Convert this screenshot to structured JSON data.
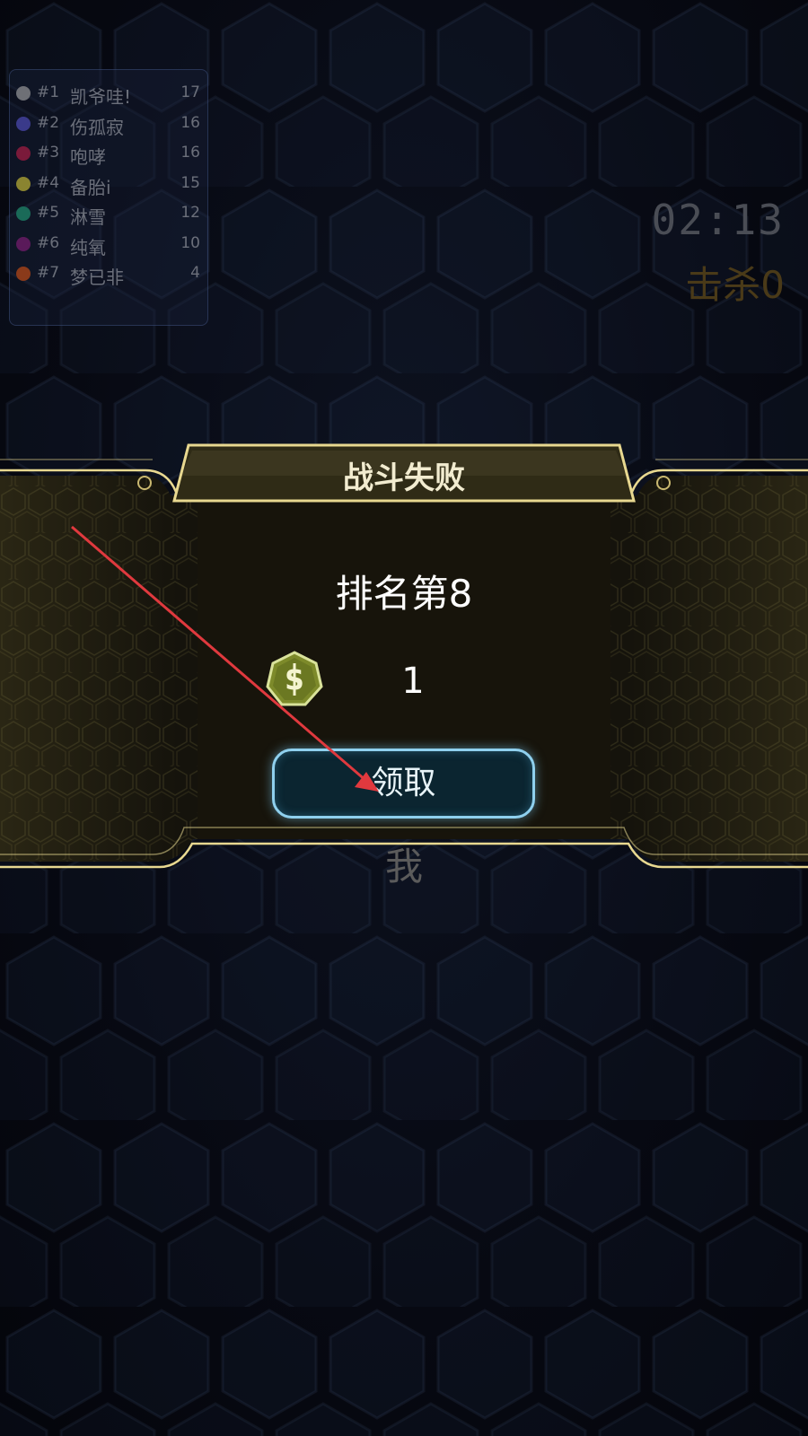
{
  "leaderboard": {
    "rows": [
      {
        "rank": "#1",
        "name": "凯爷哇!",
        "score": "17",
        "color": "#6e7076"
      },
      {
        "rank": "#2",
        "name": "伤孤寂",
        "score": "16",
        "color": "#3a3a8a"
      },
      {
        "rank": "#3",
        "name": "咆哮",
        "score": "16",
        "color": "#7a1a3a"
      },
      {
        "rank": "#4",
        "name": "备胎i",
        "score": "15",
        "color": "#8a8430"
      },
      {
        "rank": "#5",
        "name": "淋雪",
        "score": "12",
        "color": "#1a6a58"
      },
      {
        "rank": "#6",
        "name": "纯氧",
        "score": "10",
        "color": "#5a1a5a"
      },
      {
        "rank": "#7",
        "name": "梦已非",
        "score": "4",
        "color": "#8a3a1a"
      }
    ]
  },
  "hud": {
    "timer": "02:13",
    "kills": "击杀0"
  },
  "dialog": {
    "title": "战斗失败",
    "rank_text": "排名第8",
    "coin_icon": "coin-icon",
    "reward_amount": "1",
    "claim_label": "领取"
  },
  "player_label": "我",
  "colors": {
    "frame_gold": "#e8d890",
    "button_border": "#8fd0ee",
    "arrow": "#e0393e"
  }
}
